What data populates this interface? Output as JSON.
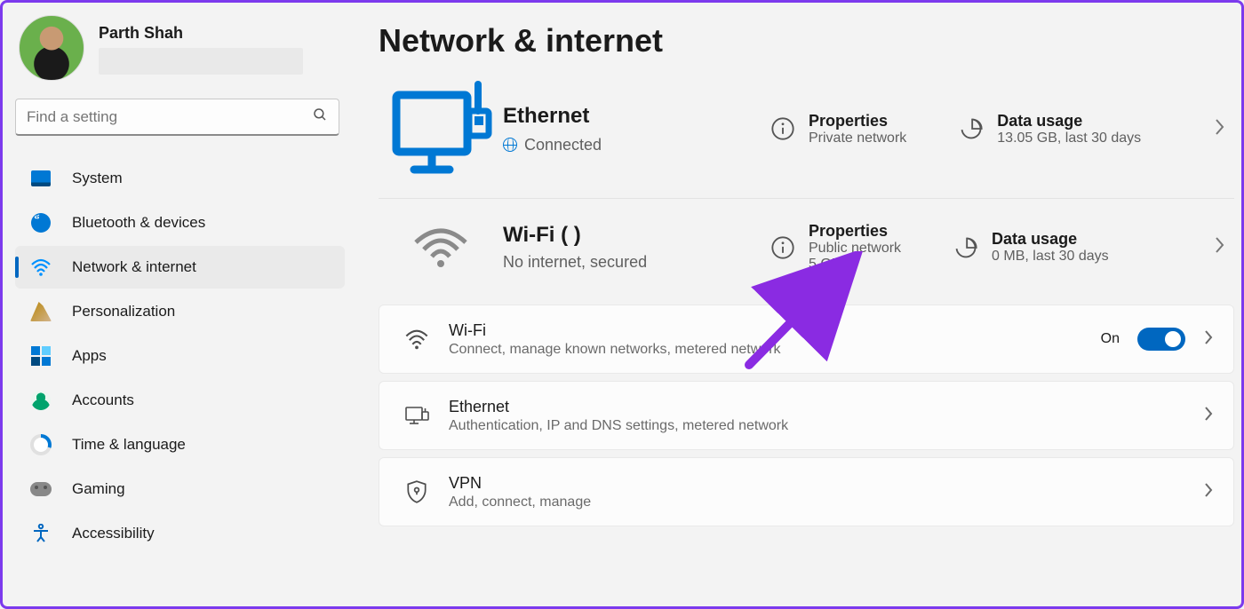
{
  "user": {
    "name": "Parth Shah"
  },
  "search": {
    "placeholder": "Find a setting"
  },
  "sidebar": {
    "items": [
      {
        "id": "system",
        "label": "System"
      },
      {
        "id": "bluetooth",
        "label": "Bluetooth & devices"
      },
      {
        "id": "network",
        "label": "Network & internet",
        "selected": true
      },
      {
        "id": "personalization",
        "label": "Personalization"
      },
      {
        "id": "apps",
        "label": "Apps"
      },
      {
        "id": "accounts",
        "label": "Accounts"
      },
      {
        "id": "time",
        "label": "Time & language"
      },
      {
        "id": "gaming",
        "label": "Gaming"
      },
      {
        "id": "accessibility",
        "label": "Accessibility"
      }
    ]
  },
  "page": {
    "title": "Network & internet"
  },
  "ethernet": {
    "title": "Ethernet",
    "status": "Connected",
    "properties": {
      "heading": "Properties",
      "sub": "Private network"
    },
    "usage": {
      "heading": "Data usage",
      "sub": "13.05 GB, last 30 days"
    }
  },
  "wifiStatus": {
    "title": "Wi-Fi (",
    "title_suffix": ")",
    "status": "No internet, secured",
    "properties": {
      "heading": "Properties",
      "sub1": "Public network",
      "sub2": "5 GHz"
    },
    "usage": {
      "heading": "Data usage",
      "sub": "0 MB, last 30 days"
    }
  },
  "cards": {
    "wifi": {
      "title": "Wi-Fi",
      "desc": "Connect, manage known networks, metered network",
      "toggle_label": "On",
      "toggle_on": true
    },
    "ethernet": {
      "title": "Ethernet",
      "desc": "Authentication, IP and DNS settings, metered network"
    },
    "vpn": {
      "title": "VPN",
      "desc": "Add, connect, manage"
    }
  }
}
